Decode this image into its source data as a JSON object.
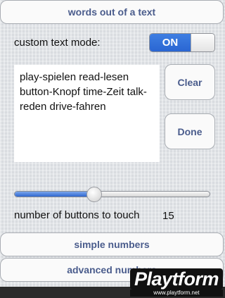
{
  "mode_buttons": {
    "words": "words out of a text",
    "simple": "simple numbers",
    "advanced": "advanced numbers"
  },
  "custom_text_mode": {
    "label": "custom text mode:",
    "toggle_state": "ON"
  },
  "text_content": "play-spielen read-lesen button-Knopf time-Zeit talk-reden drive-fahren",
  "buttons": {
    "clear": "Clear",
    "done": "Done"
  },
  "buttons_count": {
    "label": "number of buttons to touch",
    "value": "15",
    "slider_fraction": 0.41
  },
  "watermark": {
    "brand": "Playtform",
    "url": "www.playtform.net"
  },
  "colors": {
    "accent": "#2a66d2",
    "button_text": "#4a5c8c"
  }
}
